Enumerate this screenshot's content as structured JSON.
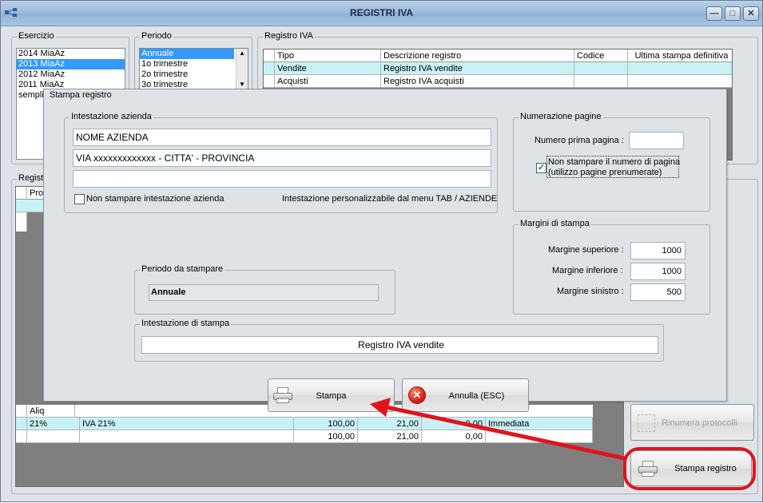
{
  "window": {
    "title": "REGISTRI IVA"
  },
  "esercizio": {
    "label": "Esercizio",
    "items": [
      "2014 MiaAz",
      "2013 MiaAz",
      "2012 MiaAz",
      "2011 MiaAz",
      "semplif"
    ]
  },
  "periodo": {
    "label": "Periodo",
    "items": [
      "Annuale",
      "1o trimestre",
      "2o trimestre",
      "3o trimestre"
    ]
  },
  "registro_iva": {
    "label": "Registro IVA",
    "columns": [
      "Tipo",
      "Descrizione registro",
      "Codice",
      "Ultima stampa definitiva"
    ],
    "rows": [
      {
        "tipo": "Vendite",
        "descrizione": "Registro IVA vendite",
        "codice": "",
        "ultima": ""
      },
      {
        "tipo": "Acquisti",
        "descrizione": "Registro IVA acquisti",
        "codice": "",
        "ultima": ""
      }
    ]
  },
  "registrazioni": {
    "label": "Regist",
    "col_prot": "Prot"
  },
  "riepilogo": {
    "col_aliquota": "Aliq",
    "row1": {
      "aliquota": "21%",
      "descrizione": "IVA 21%",
      "imponibile": "100,00",
      "imposta": "21,00",
      "indetraibile": "0,00",
      "esigibilita": "Immediata"
    },
    "totali": {
      "imponibile": "100,00",
      "imposta": "21,00",
      "indetraibile": "0,00"
    }
  },
  "buttons": {
    "rinumera": "Rinumera protocolli",
    "stampa_registro": "Stampa registro"
  },
  "dialog": {
    "title": "Stampa registro",
    "intestazione_azienda": {
      "label": "Intestazione azienda",
      "riga1": "NOME AZIENDA",
      "riga2": "VIA xxxxxxxxxxxxx - CITTA' - PROVINCIA",
      "riga3": "",
      "non_stampare": "Non stampare intestazione azienda",
      "nota": "Intestazione personalizzabile dal menu TAB / AZIENDE"
    },
    "numerazione": {
      "label": "Numerazione pagine",
      "numero_prima_label": "Numero prima pagina :",
      "numero_prima_value": "",
      "non_stampare_line1": "Non stampare il numero di pagina",
      "non_stampare_line2": "(utilizzo pagine prenumerate)"
    },
    "margini": {
      "label": "Margini di stampa",
      "superiore_label": "Margine superiore :",
      "superiore_value": "1000",
      "inferiore_label": "Margine inferiore :",
      "inferiore_value": "1000",
      "sinistro_label": "Margine sinistro :",
      "sinistro_value": "500"
    },
    "periodo": {
      "label": "Periodo da stampare",
      "value": "Annuale"
    },
    "intestazione_stampa": {
      "label": "Intestazione di stampa",
      "value": "Registro IVA vendite"
    },
    "stampa_button": "Stampa",
    "annulla_button": "Annulla (ESC)"
  },
  "colors": {
    "annotation": "#e0141e",
    "selection": "#3399ff",
    "row_highlight": "#c8f1f5"
  }
}
